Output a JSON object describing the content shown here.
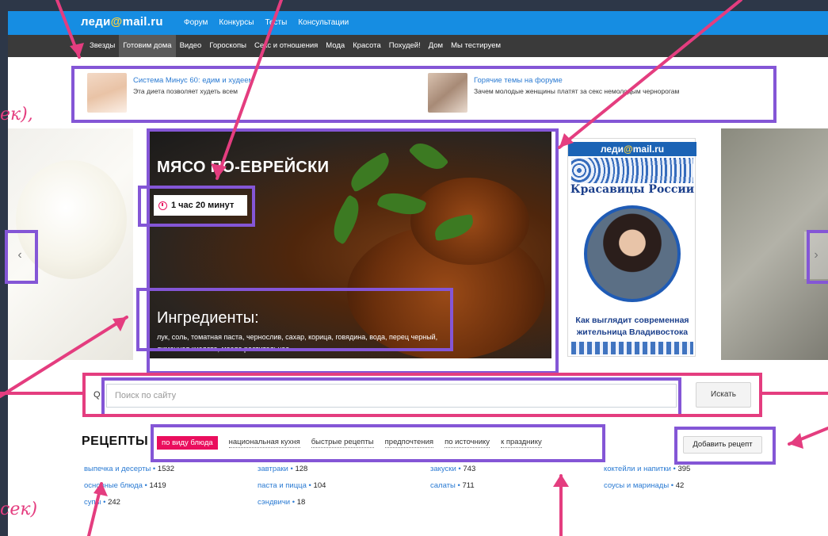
{
  "header": {
    "logo_prefix": "леди",
    "logo_at": "@",
    "logo_suffix": "mail.ru",
    "links": [
      "Форум",
      "Конкурсы",
      "Тесты",
      "Консультации"
    ]
  },
  "categories": [
    {
      "label": "Звезды",
      "active": false
    },
    {
      "label": "Готовим дома",
      "active": true
    },
    {
      "label": "Видео",
      "active": false
    },
    {
      "label": "Гороскопы",
      "active": false
    },
    {
      "label": "Секс и отношения",
      "active": false
    },
    {
      "label": "Мода",
      "active": false
    },
    {
      "label": "Красота",
      "active": false
    },
    {
      "label": "Похудей!",
      "active": false
    },
    {
      "label": "Дом",
      "active": false
    },
    {
      "label": "Мы тестируем",
      "active": false
    }
  ],
  "promos": [
    {
      "title": "Система Минус 60: едим и худеем",
      "text": "Эта диета позволяет худеть всем"
    },
    {
      "title": "Горячие темы на форуме",
      "text": "Зачем молодые женщины платят за секс немолодым чернорогам"
    }
  ],
  "hero": {
    "title": "МЯСО ПО-ЕВРЕЙСКИ",
    "time": "1 час 20 минут",
    "ingredients_title": "Ингредиенты:",
    "ingredients_text": "лук, соль, томатная паста, чернослив, сахар, корица, говядина, вода, перец черный, лимонная кислота, масло растительное"
  },
  "ad": {
    "logo_prefix": "леди",
    "logo_at": "@",
    "logo_suffix": "mail.ru",
    "title": "Красавицы России",
    "caption": "Как выглядит современная жительница Владивостока"
  },
  "carousel": {
    "prev_label": "‹",
    "next_label": "›"
  },
  "search": {
    "placeholder": "Поиск по сайту",
    "button_label": "Искать",
    "icon_glyph": "Q"
  },
  "recipes": {
    "title": "РЕЦЕПТЫ",
    "add_label": "Добавить рецепт",
    "filters": [
      {
        "label": "по виду блюда",
        "active": true
      },
      {
        "label": "национальная кухня",
        "active": false
      },
      {
        "label": "быстрые рецепты",
        "active": false
      },
      {
        "label": "предпочтения",
        "active": false
      },
      {
        "label": "по источнику",
        "active": false
      },
      {
        "label": "к празднику",
        "active": false
      }
    ],
    "columns": [
      [
        {
          "name": "выпечка и десерты",
          "count": "1532"
        },
        {
          "name": "основные блюда",
          "count": "1419"
        },
        {
          "name": "супы",
          "count": "242"
        }
      ],
      [
        {
          "name": "завтраки",
          "count": "128"
        },
        {
          "name": "паста и пицца",
          "count": "104"
        },
        {
          "name": "сэндвичи",
          "count": "18"
        }
      ],
      [
        {
          "name": "закуски",
          "count": "743"
        },
        {
          "name": "салаты",
          "count": "711"
        }
      ],
      [
        {
          "name": "коктейли и напитки",
          "count": "395"
        },
        {
          "name": "соусы и маринады",
          "count": "42"
        }
      ]
    ]
  },
  "annotations": {
    "scribble_top": "ек),",
    "scribble_bottom": "сек)",
    "highlight_color": "#8456d6",
    "arrow_color": "#e43d7f"
  },
  "colors": {
    "topbar": "#168de2",
    "catbar": "#3a3a3a",
    "accent": "#ea0e5d",
    "link": "#2b7bd3"
  }
}
